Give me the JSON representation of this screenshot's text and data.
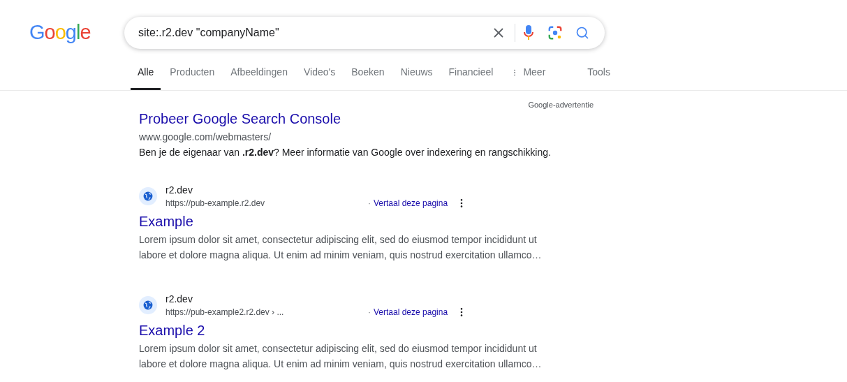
{
  "logo": "Google",
  "search": {
    "value": "site:.r2.dev \"companyName\""
  },
  "tabs": [
    {
      "label": "Alle",
      "selected": true
    },
    {
      "label": "Producten",
      "selected": false
    },
    {
      "label": "Afbeeldingen",
      "selected": false
    },
    {
      "label": "Video's",
      "selected": false
    },
    {
      "label": "Boeken",
      "selected": false
    },
    {
      "label": "Nieuws",
      "selected": false
    },
    {
      "label": "Financieel",
      "selected": false
    }
  ],
  "more": "Meer",
  "tools": "Tools",
  "ad": {
    "label": "Google-advertentie",
    "title": "Probeer Google Search Console",
    "url": "www.google.com/webmasters/",
    "description": "Ben je de eigenaar van **.r2.dev**? Meer informatie van Google over indexering en rangschikking."
  },
  "results": [
    {
      "site": "r2.dev",
      "url": "https://pub-example.r2.dev",
      "separator": "·",
      "translate": "Vertaal deze pagina",
      "title": "Example",
      "snippet": "Lorem ipsum dolor sit amet, consectetur adipiscing elit, sed do eiusmod tempor incididunt ut labore et dolore magna aliqua. Ut enim ad minim veniam, quis nostrud exercitation ullamco…"
    },
    {
      "site": "r2.dev",
      "url": "https://pub-example2.r2.dev › ...",
      "separator": "·",
      "translate": "Vertaal deze pagina",
      "title": "Example 2",
      "snippet": "Lorem ipsum dolor sit amet, consectetur adipiscing elit, sed do eiusmod tempor incididunt ut labore et dolore magna aliqua. Ut enim ad minim veniam, quis nostrud exercitation ullamco…"
    }
  ]
}
